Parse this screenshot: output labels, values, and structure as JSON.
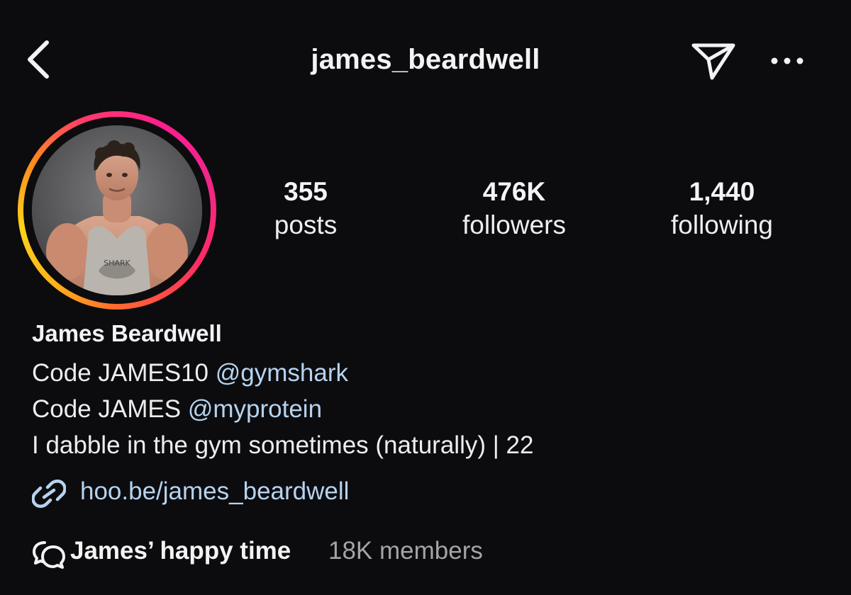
{
  "header": {
    "title": "james_beardwell",
    "back_icon": "chevron-left-icon",
    "send_icon": "paper-plane-icon",
    "more_icon": "more-horizontal-icon"
  },
  "profile": {
    "avatar_ring_colors": [
      "#fd1d8f",
      "#ff6a2e",
      "#ffd21a"
    ],
    "stats": {
      "posts": {
        "value": "355",
        "label": "posts"
      },
      "followers": {
        "value": "476K",
        "label": "followers"
      },
      "following": {
        "value": "1,440",
        "label": "following"
      }
    },
    "name": "James Beardwell",
    "bio": {
      "line1_text": "Code JAMES10",
      "line1_mention": "@gymshark",
      "line2_text": "Code JAMES",
      "line2_mention": "@myprotein",
      "line3_text": "I dabble in the gym sometimes (naturally) | 22"
    },
    "link": {
      "icon": "link-icon",
      "text": "hoo.be/james_beardwell"
    },
    "community": {
      "icon": "chat-bubbles-icon",
      "name": "James’ happy time",
      "members": "18K members"
    }
  },
  "colors": {
    "background": "#0c0c0f",
    "text": "#f3f3f3",
    "link": "#b6d3ef",
    "muted": "#a3a3a8"
  }
}
